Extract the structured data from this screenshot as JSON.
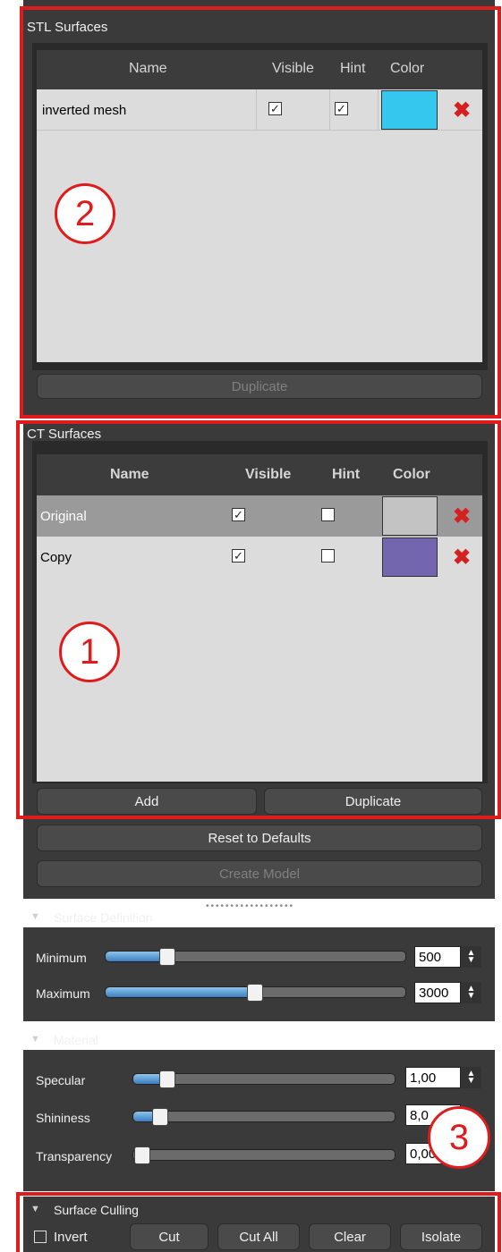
{
  "stl": {
    "title": "STL Surfaces",
    "columns": [
      "Name",
      "Visible",
      "Hint",
      "Color"
    ],
    "rows": [
      {
        "name": "inverted mesh",
        "visible": true,
        "hint": true,
        "color": "#35c8ef"
      }
    ],
    "duplicate_label": "Duplicate",
    "marker": "2"
  },
  "ct": {
    "title": "CT Surfaces",
    "columns": [
      "Name",
      "Visible",
      "Hint",
      "Color"
    ],
    "rows": [
      {
        "name": "Original",
        "visible": true,
        "hint": false,
        "color": "#c3c3c3"
      },
      {
        "name": "Copy",
        "visible": true,
        "hint": false,
        "color": "#7366ae"
      }
    ],
    "add_label": "Add",
    "duplicate_label": "Duplicate",
    "marker": "1"
  },
  "actions": {
    "reset_label": "Reset to Defaults",
    "create_label": "Create Model"
  },
  "surface_definition": {
    "title": "Surface Definition",
    "minimum": {
      "label": "Minimum",
      "value": "500",
      "fraction": 0.2
    },
    "maximum": {
      "label": "Maximum",
      "value": "3000",
      "fraction": 0.5
    }
  },
  "material": {
    "title": "Material",
    "specular": {
      "label": "Specular",
      "value": "1,00",
      "fraction": 0.1
    },
    "shininess": {
      "label": "Shininess",
      "value": "8,0",
      "fraction": 0.08
    },
    "transparency": {
      "label": "Transparency",
      "value": "0,00",
      "fraction": 0.0
    },
    "marker": "3"
  },
  "culling": {
    "title": "Surface Culling",
    "invert_label": "Invert",
    "invert_checked": false,
    "cut_label": "Cut",
    "cut_all_label": "Cut All",
    "clear_label": "Clear",
    "isolate_label": "Isolate"
  },
  "icons": {
    "checkmark": "✓",
    "delete": "✖",
    "collapse": "▼",
    "spin_up": "▲",
    "spin_down": "▼"
  }
}
